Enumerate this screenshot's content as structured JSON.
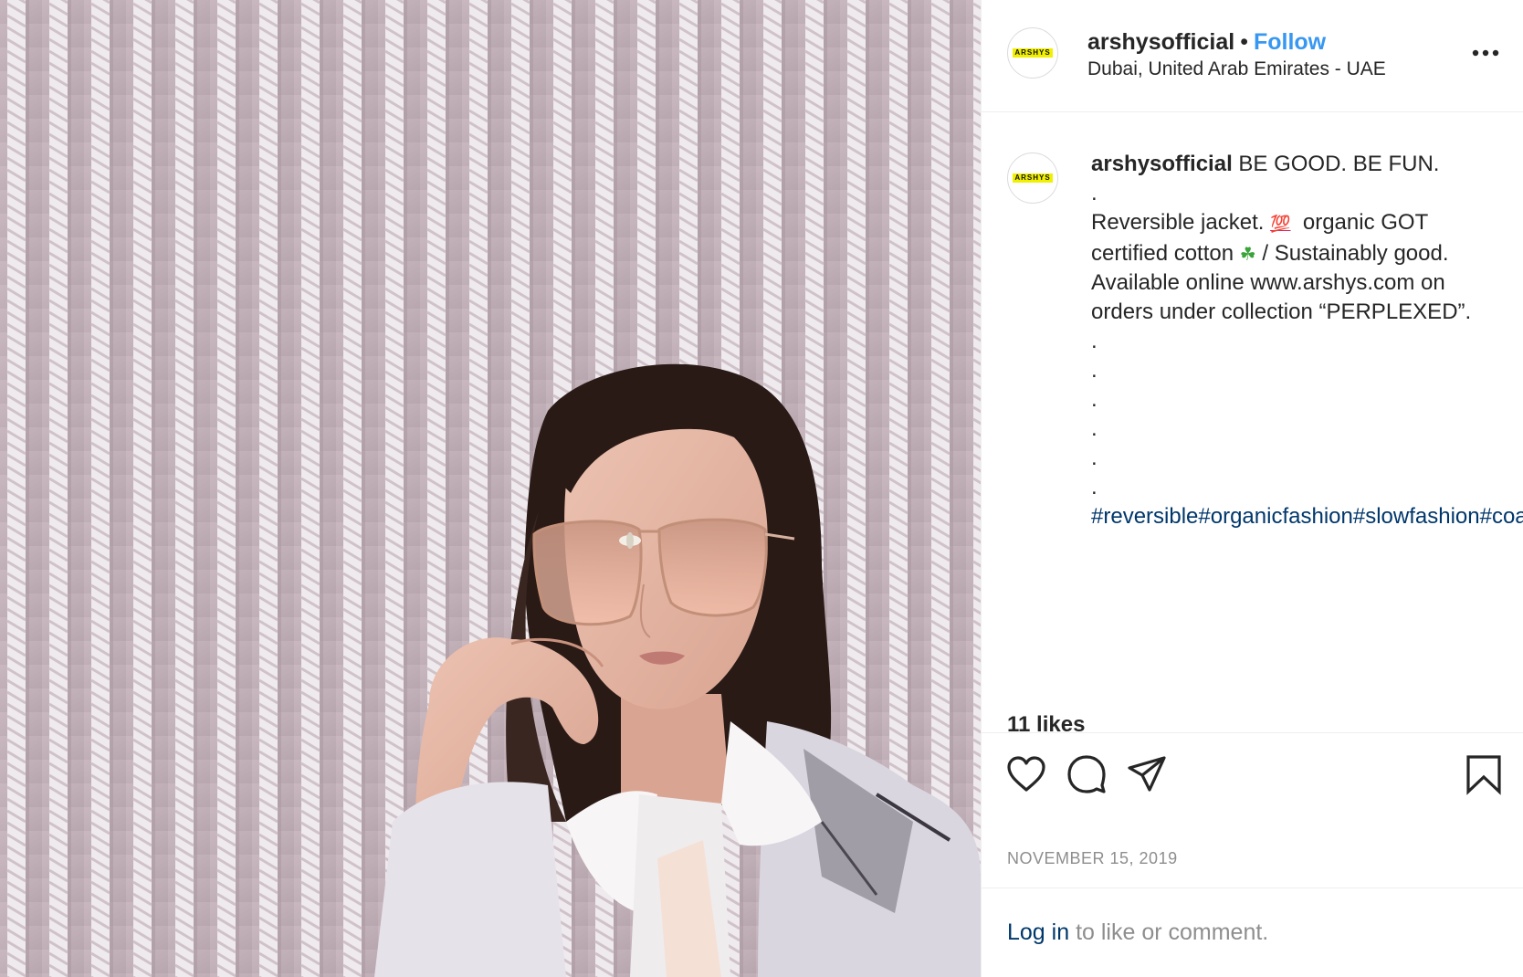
{
  "photo": {
    "description_icon": "photo-post-image",
    "colors": {
      "wall": "#c4b2b9",
      "rope": "#f4f1f3",
      "skin": "#e3b4a2",
      "hair": "#2a1a16",
      "lens": "#e9a98f",
      "collar": "#f7f5f5"
    }
  },
  "header": {
    "avatar_text": "ARSHYS",
    "username": "arshysofficial",
    "separator": "•",
    "follow_label": "Follow",
    "location": "Dubai, United Arab Emirates - UAE",
    "more_icon": "more-options-icon"
  },
  "caption": {
    "avatar_text": "ARSHYS",
    "username": "arshysofficial",
    "line1": "BE GOOD. BE FUN.",
    "dot": ".",
    "line_reversible": "Reversible jacket.",
    "emoji_100": "💯",
    "line_organic": "organic GOT",
    "line_certified": "certified cotton",
    "emoji_clover": "☘",
    "line_sustainably": "/ Sustainably good.",
    "line_available": "Available online www.arshys.com on",
    "line_orders": "orders under collection “PERPLEXED”.",
    "dots": [
      ".",
      ".",
      ".",
      ".",
      ".",
      "."
    ],
    "hashtags": "#reversible#organicfashion#slowfashion#coat#newyorkcity#nyfw#mfw#streetfashion#streetstyle#fashionweek#parisfashionweek#fashionnews#middleeast#dubai#kuwait#london#citygirl#fashionlover#fashionbuyer#styleblogger#fashionstylist#paris#abudhabi#editor#fashioneditor#fashioneditorialhair#inst"
  },
  "actions": {
    "like_icon": "heart-icon",
    "comment_icon": "comment-icon",
    "share_icon": "share-icon",
    "save_icon": "bookmark-icon"
  },
  "likes": "11 likes",
  "date": "NOVEMBER 15, 2019",
  "login": {
    "link": "Log in",
    "rest": " to like or comment."
  },
  "colors": {
    "follow": "#3897f0",
    "hashtag": "#00376b",
    "muted": "#8e8e8e",
    "text": "#262626",
    "border": "#efefef"
  }
}
